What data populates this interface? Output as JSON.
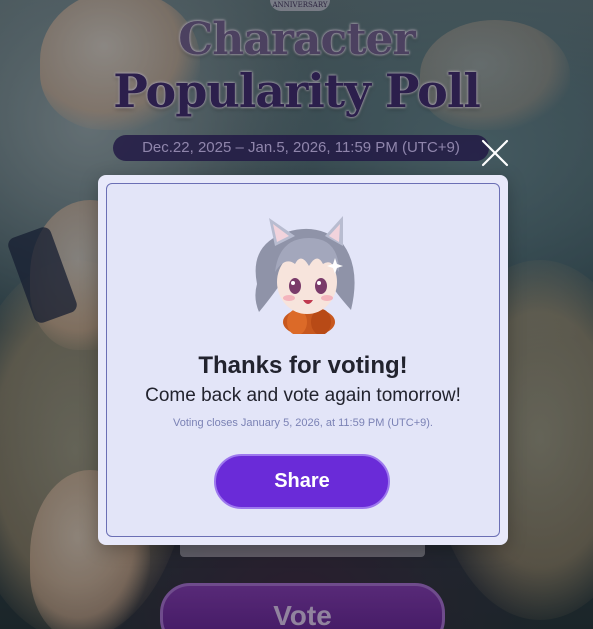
{
  "background": {
    "anniversary_badge": "ANNIVERSARY",
    "title_line1": "Character",
    "title_line2": "Popularity Poll",
    "date_range": "Dec.22, 2025 – Jan.5, 2026, 11:59 PM (UTC+9)",
    "vote_button_label": "Vote"
  },
  "modal": {
    "close_icon": "close-icon",
    "mascot_icon": "cat-eared-girl-mascot",
    "heading": "Thanks for voting!",
    "message": "Come back and vote again tomorrow!",
    "note": "Voting closes January 5, 2026, at 11:59 PM (UTC+9).",
    "share_label": "Share"
  },
  "colors": {
    "accent": "#6a2bd8",
    "modal_bg": "#e8e9fa",
    "modal_border": "#6b6fb5",
    "note_text": "#7b82b5"
  }
}
